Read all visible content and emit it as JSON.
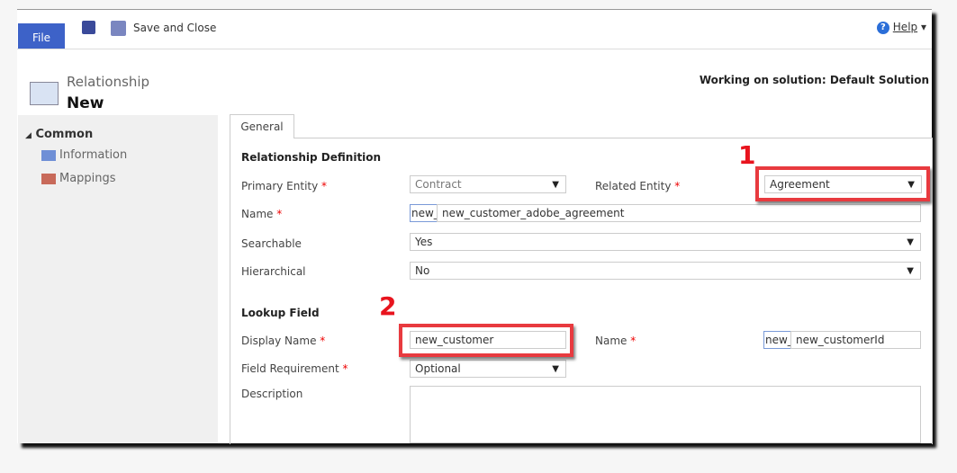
{
  "ribbon": {
    "file": "File",
    "save_close": "Save and Close",
    "help": "Help",
    "help_arrow": "▾"
  },
  "header": {
    "entity": "Relationship",
    "title": "New",
    "solution": "Working on solution: Default Solution"
  },
  "nav": {
    "group": "Common",
    "items": [
      {
        "label": "Information"
      },
      {
        "label": "Mappings"
      }
    ]
  },
  "form": {
    "tab": "General",
    "relationship_definition": {
      "heading": "Relationship Definition",
      "primary_entity": {
        "label": "Primary Entity",
        "value": "Contract"
      },
      "related_entity": {
        "label": "Related Entity",
        "value": "Agreement"
      },
      "name": {
        "label": "Name",
        "prefix": "new_",
        "value": "new_customer_adobe_agreement"
      },
      "searchable": {
        "label": "Searchable",
        "value": "Yes"
      },
      "hierarchical": {
        "label": "Hierarchical",
        "value": "No"
      }
    },
    "lookup_field": {
      "heading": "Lookup Field",
      "display_name": {
        "label": "Display Name",
        "value": "new_customer"
      },
      "name": {
        "label": "Name",
        "prefix": "new_",
        "value": "new_customerId"
      },
      "field_requirement": {
        "label": "Field Requirement",
        "value": "Optional"
      },
      "description": {
        "label": "Description",
        "value": ""
      }
    }
  },
  "annotations": {
    "one": "1",
    "two": "2"
  },
  "required_mark": "*",
  "colors": {
    "file_button": "#3d62c8",
    "highlight": "#e83a3f",
    "annotation": "#e8141e"
  }
}
